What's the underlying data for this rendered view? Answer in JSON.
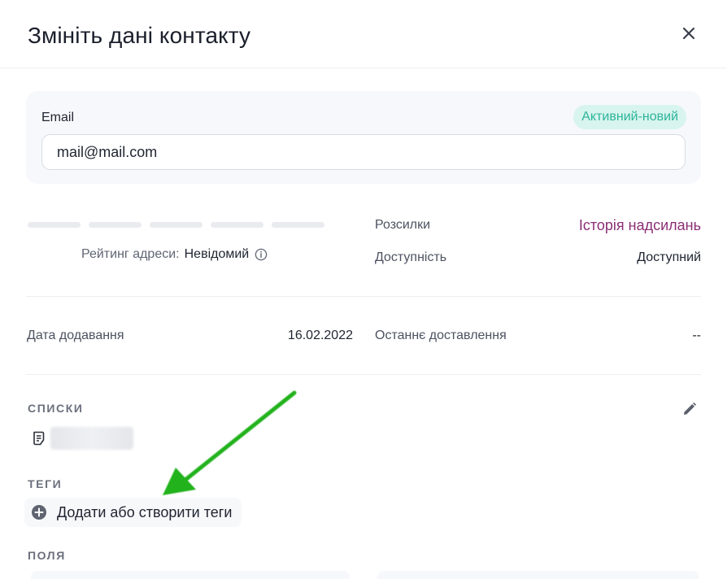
{
  "modal": {
    "title": "Змініть дані контакту"
  },
  "email_card": {
    "label": "Email",
    "value": "mail@mail.com",
    "status": "Активний-новий"
  },
  "rating": {
    "label": "Рейтинг адреси:",
    "value": "Невідомий"
  },
  "details": {
    "mailings_label": "Розсилки",
    "mailings_link": "Історія надсилань",
    "availability_label": "Доступність",
    "availability_value": "Доступний",
    "date_added_label": "Дата додавання",
    "date_added_value": "16.02.2022",
    "last_delivery_label": "Останнє доставлення",
    "last_delivery_value": "--"
  },
  "lists": {
    "title": "СПИСКИ"
  },
  "tags": {
    "title": "ТЕГИ",
    "add_label": "Додати або створити теги"
  },
  "fields": {
    "title": "ПОЛЯ"
  },
  "colors": {
    "accent_link": "#8a2f74",
    "status_bg": "#d8f4ee",
    "status_text": "#2bb59a",
    "annotation_arrow": "#22b21f"
  },
  "icons": {
    "close": "close-icon",
    "info": "info-icon",
    "edit": "pencil-icon",
    "list": "list-document-icon",
    "add": "plus-circle-icon"
  }
}
